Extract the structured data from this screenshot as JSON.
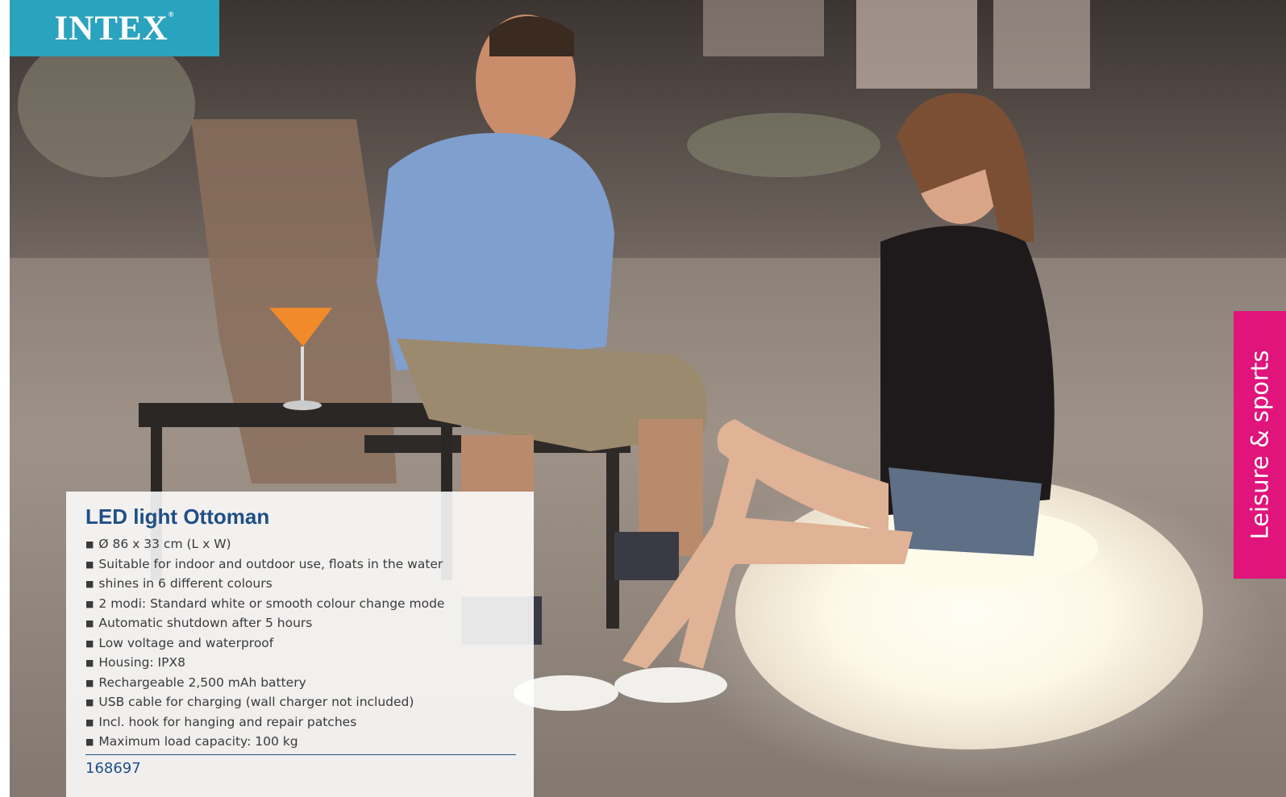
{
  "brand": {
    "logo_text": "INTEX",
    "registered_mark": "®",
    "logo_color": "#2aa3bf"
  },
  "section_tab": {
    "label": "Leisure & sports",
    "color": "#e0147a"
  },
  "product": {
    "title": "LED light Ottoman",
    "title_color": "#1f4f86",
    "bullet_icon": "square-bullet-icon",
    "features": [
      "Ø 86 x 33 cm (L x W)",
      "Suitable for indoor and outdoor use, floats in the water",
      "shines in 6 different colours",
      "2 modi: Standard white or smooth colour change mode",
      "Automatic shutdown after 5 hours",
      "Low voltage and waterproof",
      "Housing: IPX8",
      "Rechargeable 2,500 mAh battery",
      "USB cable for charging (wall charger not included)",
      "Incl. hook for hanging and repair patches",
      "Maximum load capacity: 100 kg"
    ],
    "article_number": "168697"
  }
}
